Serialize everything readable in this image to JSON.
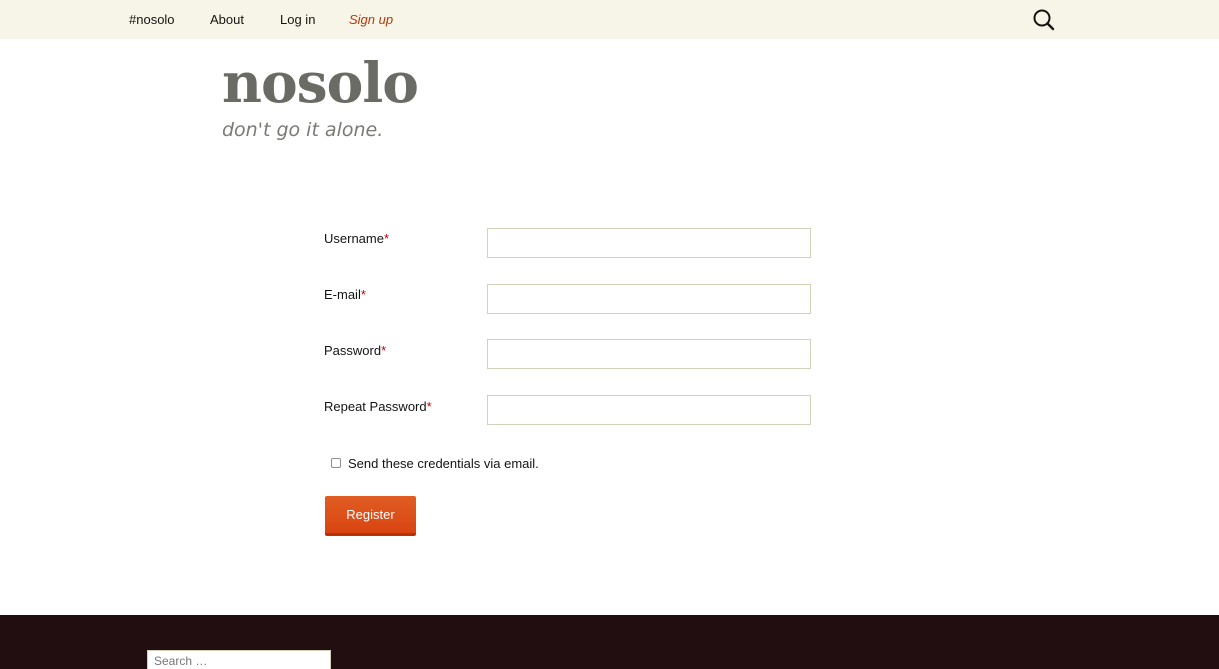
{
  "nav": {
    "items": [
      {
        "label": "#nosolo"
      },
      {
        "label": "About"
      },
      {
        "label": "Log in"
      },
      {
        "label": "Sign up"
      }
    ],
    "search_icon": "search-icon"
  },
  "site": {
    "title": "nosolo",
    "tagline": "don't go it alone."
  },
  "form": {
    "required_marker": "*",
    "fields": [
      {
        "label": "Username",
        "value": ""
      },
      {
        "label": "E-mail",
        "value": ""
      },
      {
        "label": "Password",
        "value": ""
      },
      {
        "label": "Repeat Password",
        "value": ""
      }
    ],
    "send_credentials_label": "Send these credentials via email.",
    "send_credentials_checked": false,
    "register_label": "Register"
  },
  "footer": {
    "search_placeholder": "Search …"
  },
  "colors": {
    "navbar_bg": "#f7f5e7",
    "accent": "#bc360a",
    "button": "#e05d22",
    "footer_bg": "#220e10"
  }
}
